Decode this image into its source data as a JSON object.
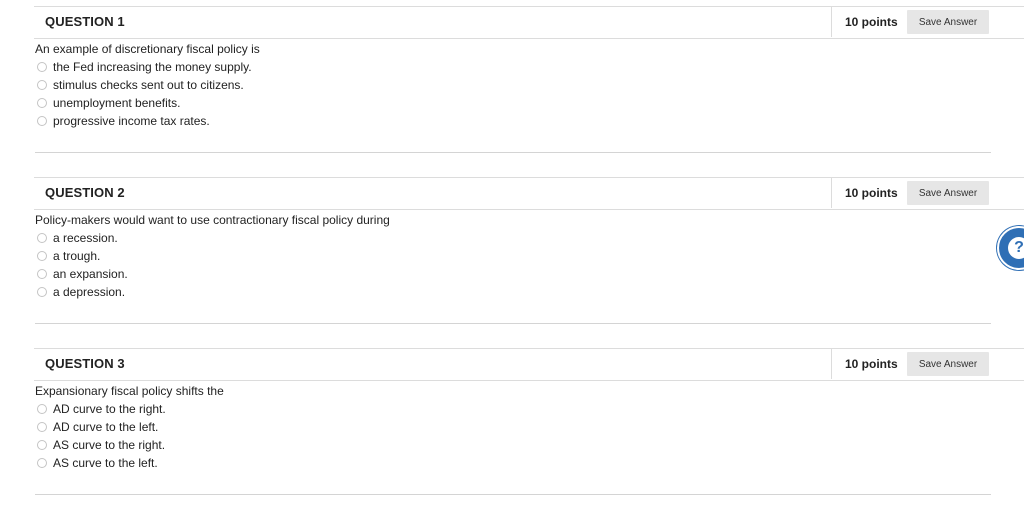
{
  "questions": [
    {
      "title": "QUESTION 1",
      "points": "10 points",
      "save_label": "Save Answer",
      "text": "An example of discretionary fiscal policy is",
      "options": [
        "the Fed increasing the money supply.",
        "stimulus checks sent out to citizens.",
        "unemployment benefits.",
        "progressive income tax rates."
      ]
    },
    {
      "title": "QUESTION 2",
      "points": "10 points",
      "save_label": "Save Answer",
      "text": "Policy-makers would want to use contractionary fiscal policy during",
      "options": [
        "a recession.",
        "a trough.",
        "an expansion.",
        "a depression."
      ]
    },
    {
      "title": "QUESTION 3",
      "points": "10 points",
      "save_label": "Save Answer",
      "text": "Expansionary fiscal policy shifts the",
      "options": [
        "AD curve to the right.",
        "AD curve to the left.",
        "AS curve to the right.",
        "AS curve to the left."
      ]
    }
  ],
  "help": {
    "glyph": "?",
    "icon": "help-icon",
    "color": "#2f6fb5"
  }
}
